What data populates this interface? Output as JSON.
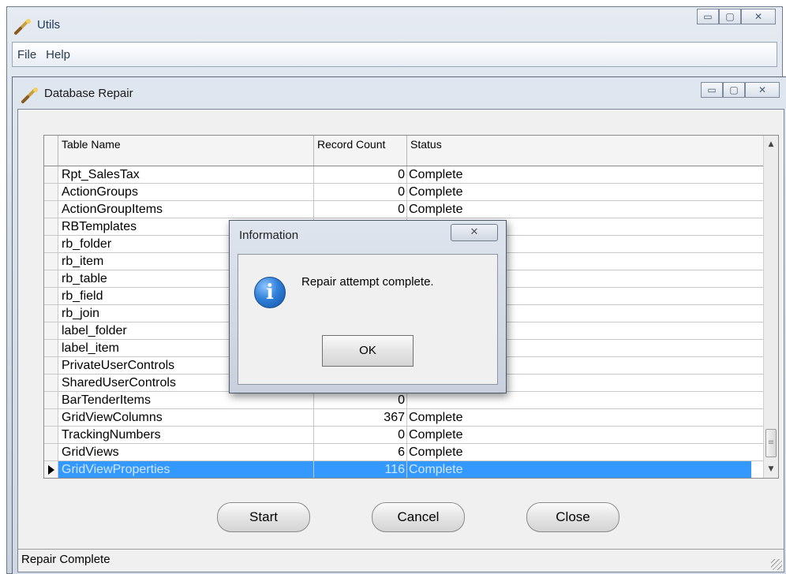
{
  "app": {
    "title": "Utils",
    "menu": [
      "File",
      "Help"
    ],
    "window_controls": {
      "minimize": "▭",
      "restore": "▢",
      "close": "✕"
    }
  },
  "child_window": {
    "title": "Database Repair",
    "window_controls": {
      "minimize": "▭",
      "restore": "▢",
      "close": "✕"
    }
  },
  "grid": {
    "columns": [
      "Table Name",
      "Record Count",
      "Status"
    ],
    "rows": [
      {
        "name": "Rpt_SalesTax",
        "count": "0",
        "status": "Complete"
      },
      {
        "name": "ActionGroups",
        "count": "0",
        "status": "Complete"
      },
      {
        "name": "ActionGroupItems",
        "count": "0",
        "status": "Complete"
      },
      {
        "name": "RBTemplates",
        "count": "",
        "status": ""
      },
      {
        "name": "rb_folder",
        "count": "",
        "status": ""
      },
      {
        "name": "rb_item",
        "count": "",
        "status": ""
      },
      {
        "name": "rb_table",
        "count": "",
        "status": ""
      },
      {
        "name": "rb_field",
        "count": "",
        "status": ""
      },
      {
        "name": "rb_join",
        "count": "",
        "status": ""
      },
      {
        "name": "label_folder",
        "count": "",
        "status": ""
      },
      {
        "name": "label_item",
        "count": "",
        "status": ""
      },
      {
        "name": "PrivateUserControls",
        "count": "",
        "status": ""
      },
      {
        "name": "SharedUserControls",
        "count": "",
        "status": ""
      },
      {
        "name": "BarTenderItems",
        "count": "0",
        "status": ""
      },
      {
        "name": "GridViewColumns",
        "count": "367",
        "status": "Complete"
      },
      {
        "name": "TrackingNumbers",
        "count": "0",
        "status": "Complete"
      },
      {
        "name": "GridViews",
        "count": "6",
        "status": "Complete"
      },
      {
        "name": "GridViewProperties",
        "count": "116",
        "status": "Complete",
        "selected": true
      }
    ]
  },
  "buttons": {
    "start": "Start",
    "cancel": "Cancel",
    "close": "Close"
  },
  "status_bar": "Repair Complete",
  "dialog": {
    "title": "Information",
    "message": "Repair attempt complete.",
    "ok": "OK",
    "icon": "information-icon",
    "close_glyph": "✕"
  },
  "colors": {
    "selection": "#3399ff",
    "title_text": "#1e395b"
  }
}
